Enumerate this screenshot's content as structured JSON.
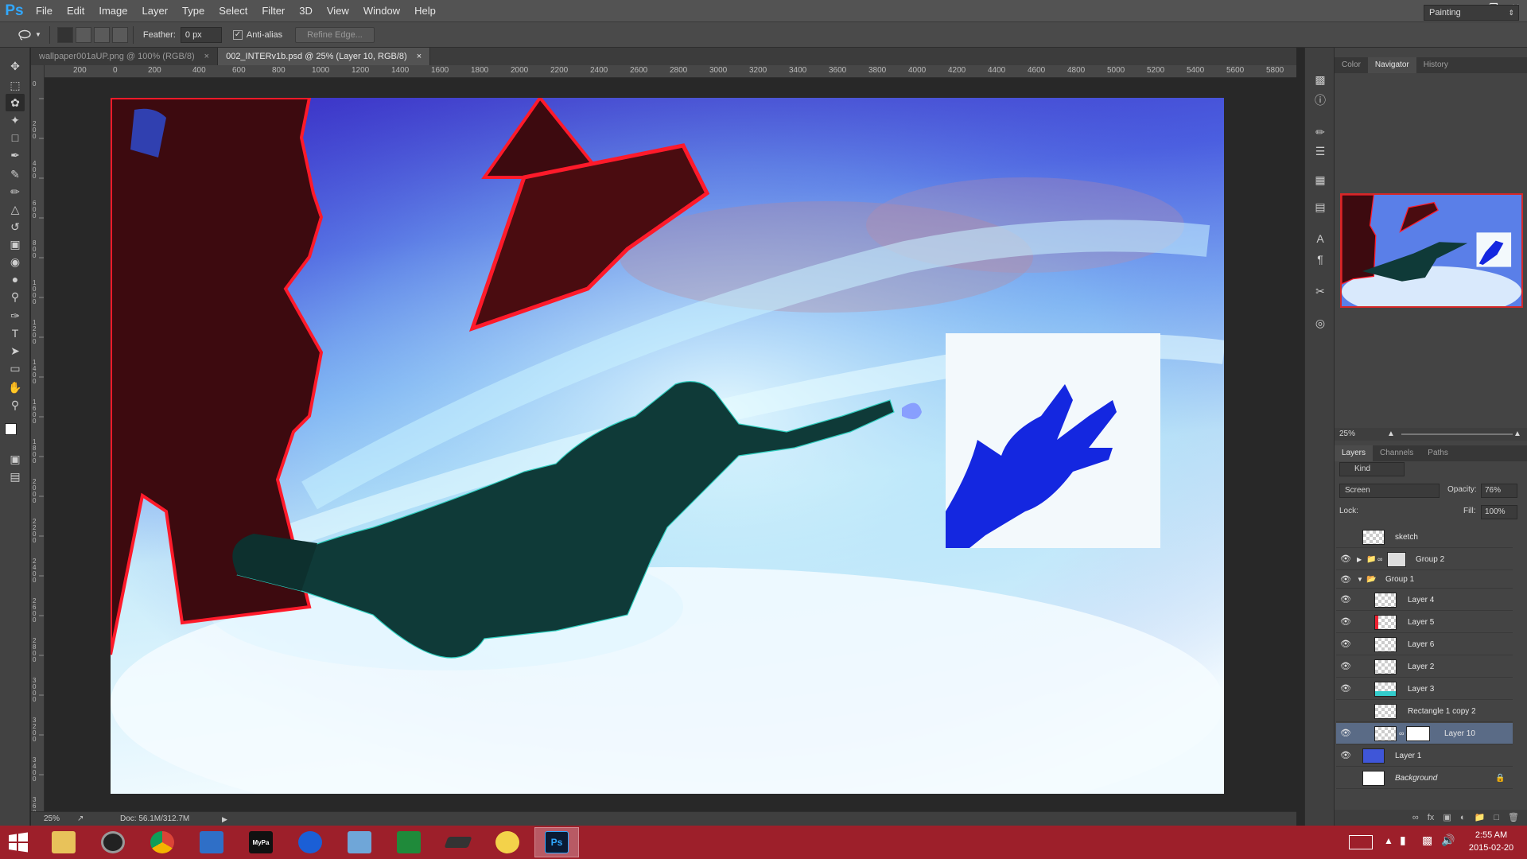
{
  "app": {
    "logo": "Ps"
  },
  "menu": [
    "File",
    "Edit",
    "Image",
    "Layer",
    "Type",
    "Select",
    "Filter",
    "3D",
    "View",
    "Window",
    "Help"
  ],
  "window_controls": [
    "minimize-icon",
    "restore-icon",
    "close-icon"
  ],
  "options": {
    "tool_icon": "lasso-icon",
    "feather_label": "Feather:",
    "feather_value": "0 px",
    "antialias_label": "Anti-alias",
    "antialias_checked": true,
    "refine_edge_label": "Refine Edge...",
    "workspace": "Painting"
  },
  "tabs": [
    {
      "title": "wallpaper001aUP.png @ 100% (RGB/8)",
      "active": false
    },
    {
      "title": "002_INTERv1b.psd @ 25% (Layer 10, RGB/8)",
      "active": true
    }
  ],
  "ruler_labels": [
    "200",
    "0",
    "200",
    "400",
    "600",
    "800",
    "1000",
    "1200",
    "1400",
    "1600",
    "1800",
    "2000",
    "2200",
    "2400",
    "2600",
    "2800",
    "3000",
    "3200",
    "3400",
    "3600",
    "3800",
    "4000",
    "4200",
    "4400",
    "4600",
    "4800",
    "5000",
    "5200",
    "5400",
    "5600",
    "5800"
  ],
  "vruler_labels": [
    "0",
    "200",
    "400",
    "600",
    "800",
    "1000",
    "1200",
    "1400",
    "1600",
    "1800",
    "2000",
    "2200",
    "2400",
    "2600",
    "2800",
    "3000",
    "3200",
    "3400",
    "3600"
  ],
  "status": {
    "zoom": "25%",
    "doc": "Doc: 56.1M/312.7M"
  },
  "panels": {
    "top_tabs": [
      "Color",
      "Navigator",
      "History"
    ],
    "top_active": "Navigator",
    "nav_zoom": "25%",
    "layer_tabs": [
      "Layers",
      "Channels",
      "Paths"
    ],
    "layers_active": "Layers",
    "filter_kind": "Kind",
    "blend_mode": "Screen",
    "opacity_label": "Opacity:",
    "opacity": "76%",
    "lock_label": "Lock:",
    "fill_label": "Fill:",
    "fill": "100%"
  },
  "layers": [
    {
      "name": "sketch",
      "visible": false,
      "indent": 0,
      "type": "layer"
    },
    {
      "name": "Group 2",
      "visible": true,
      "indent": 0,
      "type": "group-collapsed"
    },
    {
      "name": "Group 1",
      "visible": true,
      "indent": 0,
      "type": "group-open"
    },
    {
      "name": "Layer 4",
      "visible": true,
      "indent": 1,
      "type": "layer"
    },
    {
      "name": "Layer 5",
      "visible": true,
      "indent": 1,
      "type": "layer"
    },
    {
      "name": "Layer 6",
      "visible": true,
      "indent": 1,
      "type": "layer"
    },
    {
      "name": "Layer 2",
      "visible": true,
      "indent": 1,
      "type": "layer"
    },
    {
      "name": "Layer 3",
      "visible": true,
      "indent": 1,
      "type": "layer"
    },
    {
      "name": "Rectangle 1 copy 2",
      "visible": false,
      "indent": 1,
      "type": "layer"
    },
    {
      "name": "Layer 10",
      "visible": true,
      "indent": 1,
      "type": "masked",
      "selected": true
    },
    {
      "name": "Layer 1",
      "visible": true,
      "indent": 0,
      "type": "layer"
    },
    {
      "name": "Background",
      "visible": false,
      "indent": 0,
      "type": "background"
    }
  ],
  "taskbar": {
    "apps": [
      "file-explorer",
      "media-player",
      "chrome",
      "control-panel",
      "mypaint",
      "malwarebytes",
      "network-tool",
      "calculator",
      "tablet-tool",
      "pikachu-app",
      "photoshop"
    ],
    "active_app": "photoshop",
    "time": "2:55 AM",
    "date": "2015-02-20"
  },
  "colors": {
    "accent_selected": "#5a6b86",
    "taskbar": "#9d1f2a",
    "navigator_frame": "#d62828"
  }
}
